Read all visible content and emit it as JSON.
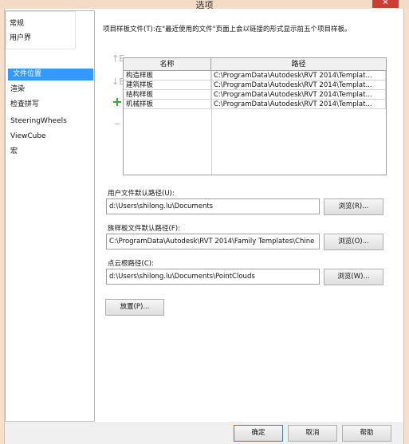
{
  "window": {
    "title": "选项",
    "close_glyph": "✕"
  },
  "sidebar": {
    "popup_items": [
      "常规",
      "用户界"
    ],
    "items": [
      {
        "label": "文件位置",
        "selected": true
      },
      {
        "label": "渲染"
      },
      {
        "label": "检查拼写"
      },
      {
        "label": "SteeringWheels"
      },
      {
        "label": "ViewCube"
      },
      {
        "label": "宏"
      }
    ]
  },
  "main": {
    "description": "项目样板文件(T):在\"最近使用的文件\"页面上会以链接的形式显示前五个项目样板。",
    "side_buttons": {
      "up": "↑E",
      "down": "↓E",
      "add": "+",
      "remove": "−"
    },
    "table": {
      "columns": [
        "名称",
        "路径"
      ],
      "rows": [
        {
          "name": "构造样板",
          "path": "C:\\ProgramData\\Autodesk\\RVT 2014\\Templat..."
        },
        {
          "name": "建筑样板",
          "path": "C:\\ProgramData\\Autodesk\\RVT 2014\\Templat..."
        },
        {
          "name": "结构样板",
          "path": "C:\\ProgramData\\Autodesk\\RVT 2014\\Templat..."
        },
        {
          "name": "机械样板",
          "path": "C:\\ProgramData\\Autodesk\\RVT 2014\\Templat..."
        }
      ]
    },
    "user_path": {
      "label": "用户文件默认路径(U):",
      "value": "d:\\Users\\shilong.lu\\Documents",
      "browse": "浏览(R)..."
    },
    "family_path": {
      "label": "族样板文件默认路径(F):",
      "value": "C:\\ProgramData\\Autodesk\\RVT 2014\\Family Templates\\Chine",
      "browse": "浏览(O)..."
    },
    "pointcloud_path": {
      "label": "点云根路径(C):",
      "value": "d:\\Users\\shilong.lu\\Documents\\PointClouds",
      "browse": "浏览(W)..."
    },
    "places_button": "放置(P)..."
  },
  "footer": {
    "ok": "确定",
    "cancel": "取消",
    "help": "帮助"
  },
  "colors": {
    "selection": "#3399ff",
    "close": "#cc3d33"
  }
}
